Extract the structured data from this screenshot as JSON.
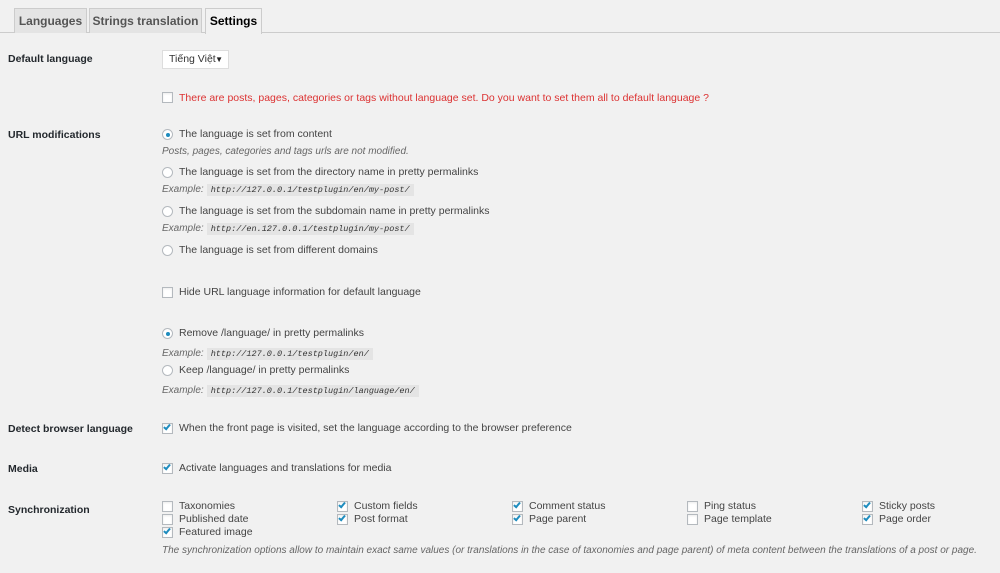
{
  "tabs": [
    {
      "label": "Languages",
      "active": false
    },
    {
      "label": "Strings translation",
      "active": false
    },
    {
      "label": "Settings",
      "active": true
    }
  ],
  "default_language": {
    "label": "Default language",
    "selected": "Tiếng Việt",
    "caret": "▼",
    "untranslated_notice": "There are posts, pages, categories or tags without language set. Do you want to set them all to default language ?",
    "untranslated_checked": false
  },
  "url_modifications": {
    "label": "URL modifications",
    "example_label": "Example:",
    "options": [
      {
        "label": "The language is set from content",
        "checked": true,
        "desc": "Posts, pages, categories and tags urls are not modified."
      },
      {
        "label": "The language is set from the directory name in pretty permalinks",
        "checked": false,
        "example": "http://127.0.0.1/testplugin/en/my-post/"
      },
      {
        "label": "The language is set from the subdomain name in pretty permalinks",
        "checked": false,
        "example": "http://en.127.0.0.1/testplugin/my-post/"
      },
      {
        "label": "The language is set from different domains",
        "checked": false
      }
    ],
    "hide_default": {
      "label": "Hide URL language information for default language",
      "checked": false
    },
    "rewrite_options": [
      {
        "label": "Remove /language/ in pretty permalinks",
        "checked": true,
        "example": "http://127.0.0.1/testplugin/en/"
      },
      {
        "label": "Keep /language/ in pretty permalinks",
        "checked": false,
        "example": "http://127.0.0.1/testplugin/language/en/"
      }
    ]
  },
  "detect_browser": {
    "label": "Detect browser language",
    "option": "When the front page is visited, set the language according to the browser preference",
    "checked": true
  },
  "media": {
    "label": "Media",
    "option": "Activate languages and translations for media",
    "checked": true
  },
  "synchronization": {
    "label": "Synchronization",
    "items": [
      {
        "label": "Taxonomies",
        "checked": false
      },
      {
        "label": "Custom fields",
        "checked": true
      },
      {
        "label": "Comment status",
        "checked": true
      },
      {
        "label": "Ping status",
        "checked": false
      },
      {
        "label": "Sticky posts",
        "checked": true
      },
      {
        "label": "Published date",
        "checked": false
      },
      {
        "label": "Post format",
        "checked": true
      },
      {
        "label": "Page parent",
        "checked": true
      },
      {
        "label": "Page template",
        "checked": false
      },
      {
        "label": "Page order",
        "checked": true
      },
      {
        "label": "Featured image",
        "checked": true
      }
    ],
    "description": "The synchronization options allow to maintain exact same values (or translations in the case of taxonomies and page parent) of meta content between the translations of a post or page."
  }
}
